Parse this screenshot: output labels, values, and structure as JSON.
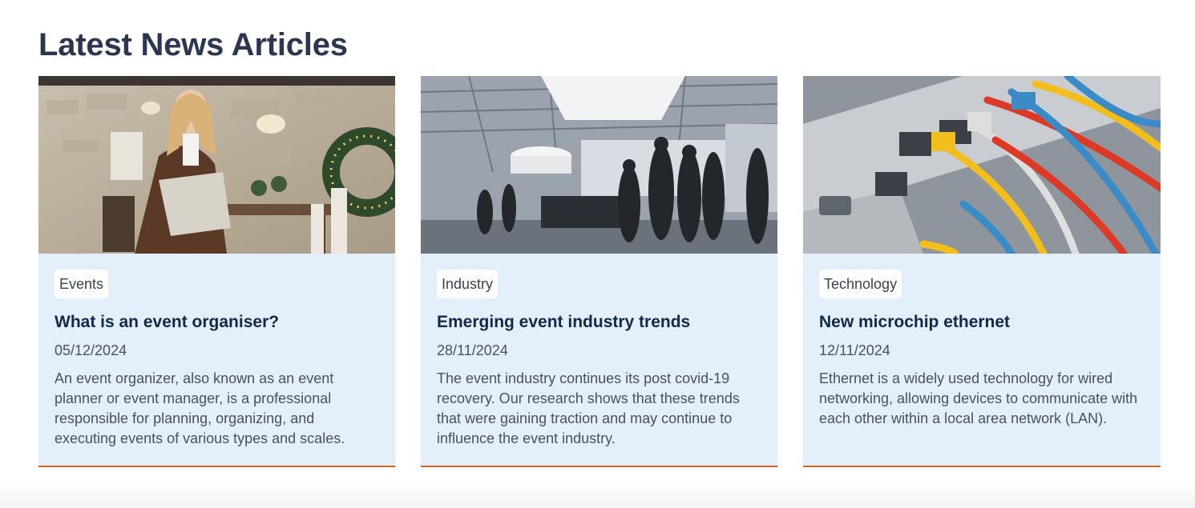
{
  "section": {
    "title": "Latest News Articles"
  },
  "cards": [
    {
      "image_alt": "Event organiser holding a folder in a decorated venue",
      "tag": "Events",
      "title": "What is an event organiser?",
      "date": "05/12/2024",
      "excerpt": "An event organizer, also known as an event planner or event manager, is a professional responsible for planning, organizing, and executing events of various types and scales."
    },
    {
      "image_alt": "Crowd walking through an exhibition hall",
      "tag": "Industry",
      "title": "Emerging event industry trends",
      "date": "28/11/2024",
      "excerpt": "The event industry continues its post covid-19 recovery. Our research shows that these trends that were gaining traction and may continue to influence the event industry."
    },
    {
      "image_alt": "Ethernet cables plugged into a network switch",
      "tag": "Technology",
      "title": "New microchip ethernet",
      "date": "12/11/2024",
      "excerpt": "Ethernet is a widely used technology for wired networking, allowing devices to communicate with each other within a local area network (LAN)."
    }
  ],
  "colors": {
    "card_background": "#e3effb",
    "card_border_accent": "#d0652b",
    "title_color": "#14294a",
    "heading_color": "#2b3750"
  }
}
